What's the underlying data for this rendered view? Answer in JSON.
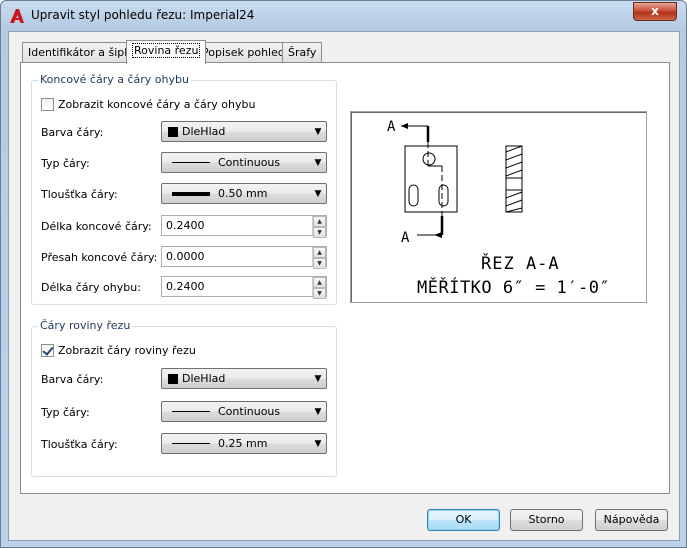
{
  "window": {
    "title": "Upravit styl pohledu řezu: Imperial24",
    "close_label": "x"
  },
  "tabs": [
    {
      "label": "Identifikátor a šipky"
    },
    {
      "label": "Rovina řezu",
      "active": true
    },
    {
      "label": "Popisek pohledu"
    },
    {
      "label": "Šrafy"
    }
  ],
  "end_lines": {
    "title": "Koncové čáry a čáry ohybu",
    "show_label": "Zobrazit koncové čáry a čáry ohybu",
    "show_checked": false,
    "color_label": "Barva čáry:",
    "color_value": "DleHlad",
    "linetype_label": "Typ čáry:",
    "linetype_value": "Continuous",
    "weight_label": "Tloušťka čáry:",
    "weight_value": "0.50 mm",
    "end_length_label": "Délka koncové čáry:",
    "end_length_value": "0.2400",
    "overshoot_label": "Přesah koncové čáry:",
    "overshoot_value": "0.0000",
    "bend_length_label": "Délka čáry ohybu:",
    "bend_length_value": "0.2400"
  },
  "plane_lines": {
    "title": "Čáry roviny řezu",
    "show_label": "Zobrazit čáry roviny řezu",
    "show_checked": true,
    "color_label": "Barva čáry:",
    "color_value": "DleHlad",
    "linetype_label": "Typ čáry:",
    "linetype_value": "Continuous",
    "weight_label": "Tloušťka čáry:",
    "weight_value": "0.25 mm"
  },
  "preview": {
    "arrow_label_top": "A",
    "arrow_label_bottom": "A",
    "caption_1": "ŘEZ A-A",
    "caption_2": "MĚŘÍTKO 6″ = 1′-0″"
  },
  "buttons": {
    "ok": "OK",
    "cancel": "Storno",
    "help": "Nápověda"
  },
  "colors": {
    "accent": "#3c7fb1",
    "title_blue": "#1e395b"
  }
}
